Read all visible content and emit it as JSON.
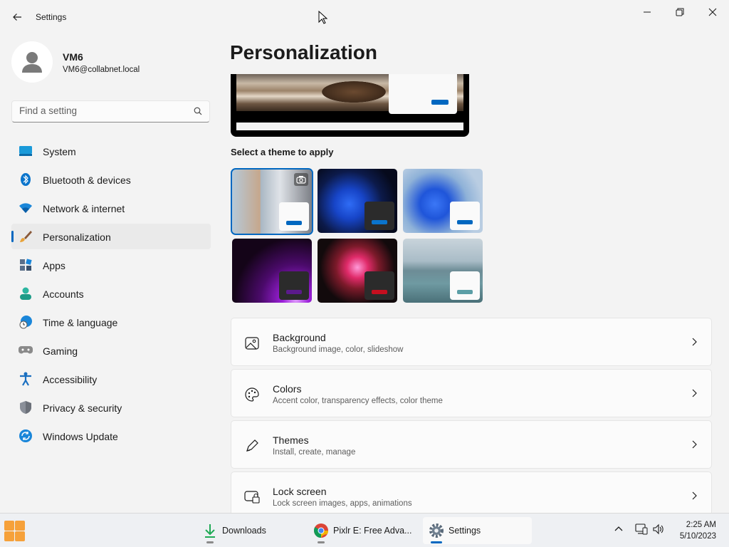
{
  "window": {
    "title": "Settings",
    "controls": [
      "minimize-icon",
      "maximize-icon",
      "close-icon"
    ]
  },
  "profile": {
    "name": "VM6",
    "email": "VM6@collabnet.local"
  },
  "search": {
    "placeholder": "Find a setting",
    "icon": "search-icon"
  },
  "sidebar": {
    "items": [
      {
        "label": "System",
        "icon": "monitor-icon",
        "active": false
      },
      {
        "label": "Bluetooth & devices",
        "icon": "bluetooth-icon",
        "active": false
      },
      {
        "label": "Network & internet",
        "icon": "wifi-icon",
        "active": false
      },
      {
        "label": "Personalization",
        "icon": "brush-icon",
        "active": true
      },
      {
        "label": "Apps",
        "icon": "apps-icon",
        "active": false
      },
      {
        "label": "Accounts",
        "icon": "person-icon",
        "active": false
      },
      {
        "label": "Time & language",
        "icon": "globe-clock-icon",
        "active": false
      },
      {
        "label": "Gaming",
        "icon": "gamepad-icon",
        "active": false
      },
      {
        "label": "Accessibility",
        "icon": "accessibility-icon",
        "active": false
      },
      {
        "label": "Privacy & security",
        "icon": "shield-icon",
        "active": false
      },
      {
        "label": "Windows Update",
        "icon": "update-icon",
        "active": false
      }
    ]
  },
  "main": {
    "title": "Personalization",
    "theme_section_label": "Select a theme to apply",
    "themes": [
      {
        "name": "theme-windows-spotlight",
        "selected": true,
        "accent": "#0067c0"
      },
      {
        "name": "theme-windows-dark",
        "selected": false,
        "accent": "#0067c0"
      },
      {
        "name": "theme-windows-light",
        "selected": false,
        "accent": "#0067c0"
      },
      {
        "name": "theme-glow",
        "selected": false,
        "accent": "#5b1a8c"
      },
      {
        "name": "theme-captured-motion",
        "selected": false,
        "accent": "#c50f1f"
      },
      {
        "name": "theme-flow",
        "selected": false,
        "accent": "#5b9ea6"
      }
    ],
    "cards": [
      {
        "title": "Background",
        "subtitle": "Background image, color, slideshow",
        "icon": "image-icon"
      },
      {
        "title": "Colors",
        "subtitle": "Accent color, transparency effects, color theme",
        "icon": "palette-icon"
      },
      {
        "title": "Themes",
        "subtitle": "Install, create, manage",
        "icon": "pen-icon"
      },
      {
        "title": "Lock screen",
        "subtitle": "Lock screen images, apps, animations",
        "icon": "lock-screen-icon"
      }
    ]
  },
  "taskbar": {
    "apps": [
      {
        "label": "Downloads",
        "icon": "download-icon",
        "active": false
      },
      {
        "label": "Pixlr E: Free Adva...",
        "icon": "chrome-icon",
        "active": false
      },
      {
        "label": "Settings",
        "icon": "settings-gear-icon",
        "active": true
      }
    ],
    "time": "2:25 AM",
    "date": "5/10/2023"
  },
  "colors": {
    "accent": "#0067c0",
    "background": "#f3f3f3",
    "card": "#fbfbfb"
  }
}
